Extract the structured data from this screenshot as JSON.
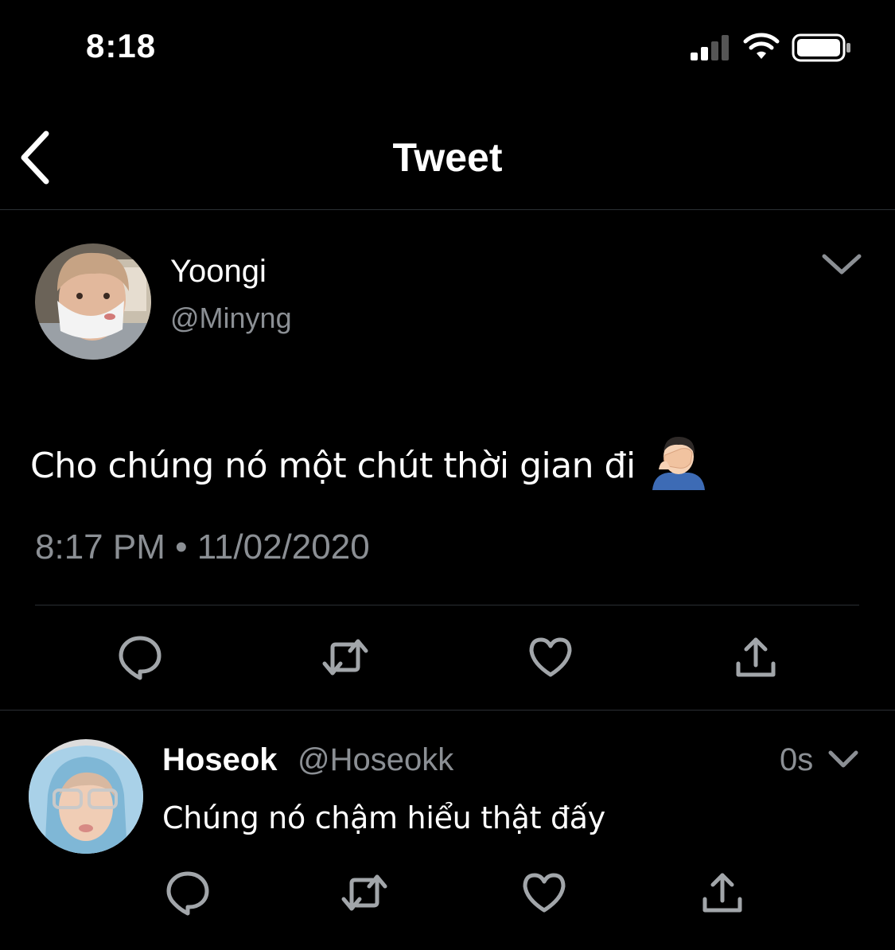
{
  "status_bar": {
    "time": "8:18",
    "icons": [
      "cellular-signal-icon",
      "wifi-icon",
      "battery-icon"
    ]
  },
  "nav": {
    "back_icon": "chevron-left-icon",
    "title": "Tweet"
  },
  "tweet": {
    "author_name": "Yoongi",
    "author_handle": "@Minyng",
    "text": "Cho chúng nó một chút thời gian đi",
    "emoji": "facepalm-emoji",
    "timestamp": "8:17 PM • 11/02/2020",
    "actions": [
      "reply-icon",
      "retweet-icon",
      "like-icon",
      "share-icon"
    ]
  },
  "reply": {
    "author_name": "Hoseok",
    "author_handle": "@Hoseokk",
    "time_ago": "0s",
    "text": "Chúng nó chậm hiểu thật đấy",
    "actions": [
      "reply-icon",
      "retweet-icon",
      "like-icon",
      "share-icon"
    ]
  },
  "colors": {
    "background": "#000000",
    "text": "#ffffff",
    "secondary_text": "#8b8f94",
    "icon": "#a2a6aa",
    "divider": "#2a2f33"
  }
}
